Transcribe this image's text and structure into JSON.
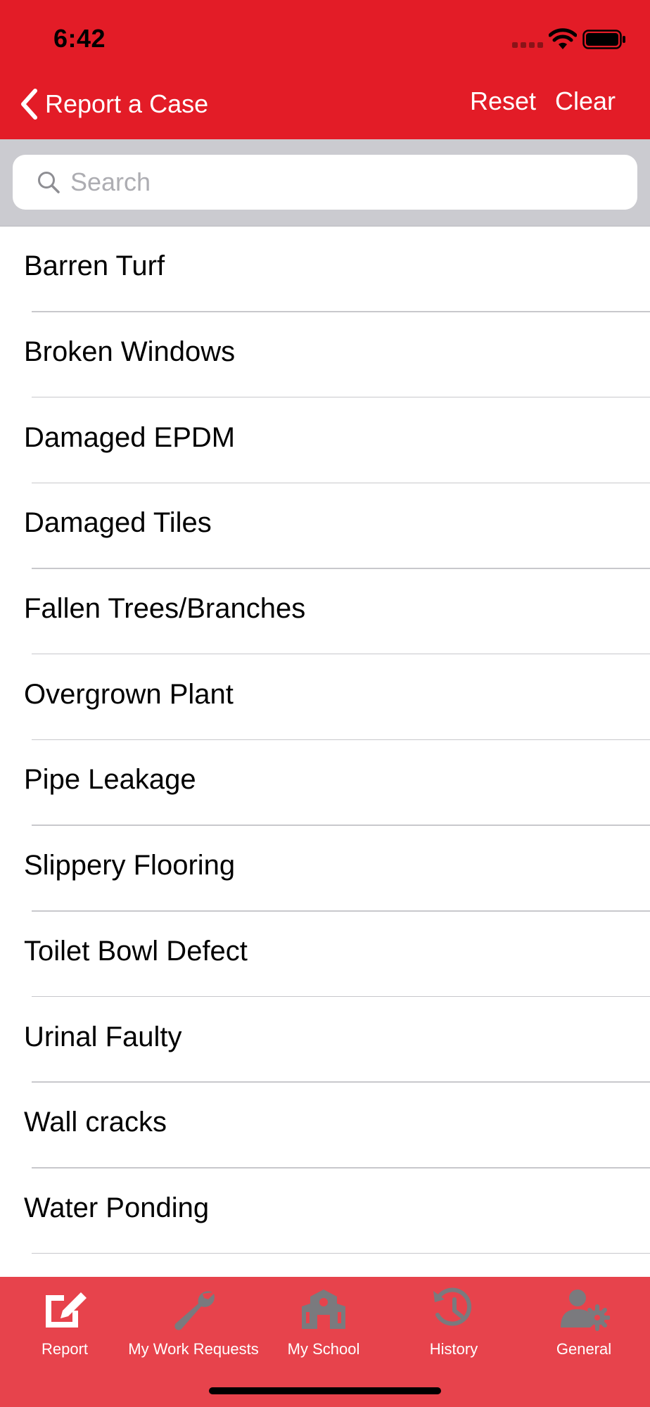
{
  "status_bar": {
    "time": "6:42"
  },
  "nav": {
    "back_label": "Report a Case",
    "reset_label": "Reset",
    "clear_label": "Clear"
  },
  "search": {
    "placeholder": "Search",
    "value": ""
  },
  "list": {
    "items": [
      "Barren Turf",
      "Broken Windows",
      "Damaged EPDM",
      "Damaged Tiles",
      "Fallen Trees/Branches",
      "Overgrown Plant",
      "Pipe Leakage",
      "Slippery Flooring",
      "Toilet Bowl Defect",
      "Urinal Faulty",
      "Wall cracks",
      "Water Ponding"
    ]
  },
  "tabs": [
    {
      "label": "Report",
      "icon": "edit-icon",
      "active": true
    },
    {
      "label": "My Work Requests",
      "icon": "wrench-icon",
      "active": false
    },
    {
      "label": "My School",
      "icon": "school-icon",
      "active": false
    },
    {
      "label": "History",
      "icon": "history-icon",
      "active": false
    },
    {
      "label": "General",
      "icon": "user-gear-icon",
      "active": false
    }
  ],
  "colors": {
    "header": "#e31c27",
    "tabbar": "#e7434c",
    "search_bar": "#cbcbd0",
    "tab_active": "#ffffff",
    "tab_inactive": "#7a7a7e"
  }
}
